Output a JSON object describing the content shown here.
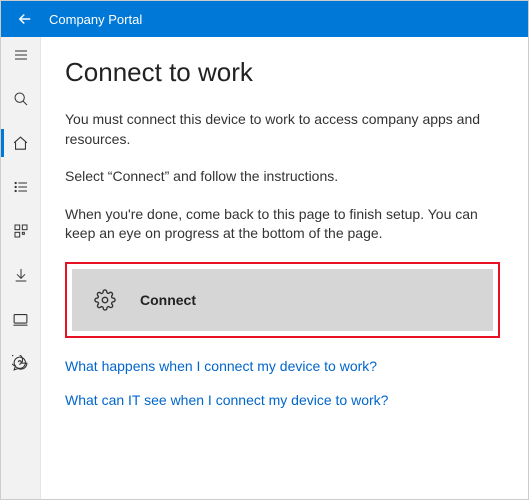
{
  "app": {
    "title": "Company Portal"
  },
  "sidebar": {
    "items": [
      {
        "icon": "hamburger-icon"
      },
      {
        "icon": "search-icon"
      },
      {
        "icon": "home-icon",
        "active": true
      },
      {
        "icon": "list-icon"
      },
      {
        "icon": "apps-icon"
      },
      {
        "icon": "download-icon"
      },
      {
        "icon": "device-icon"
      },
      {
        "icon": "support-icon"
      }
    ]
  },
  "page": {
    "title": "Connect to work",
    "para1": "You must connect this device to work to access company apps and resources.",
    "para2": "Select “Connect” and follow the instructions.",
    "para3": "When you're done, come back to this page to finish setup. You can keep an eye on progress at the bottom of the page.",
    "connect_label": "Connect",
    "link1": "What happens when I connect my device to work?",
    "link2": "What can IT see when I connect my device to work?"
  }
}
